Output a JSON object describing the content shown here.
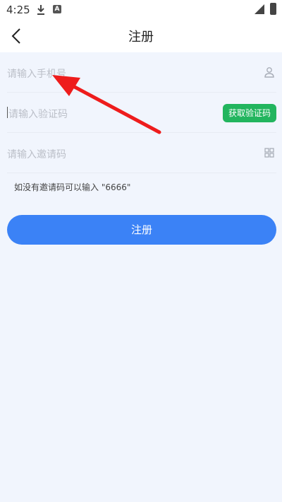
{
  "status_bar": {
    "time": "4:25"
  },
  "header": {
    "title": "注册"
  },
  "form": {
    "phone_placeholder": "请输入手机号",
    "code_placeholder": "请输入验证码",
    "get_code_label": "获取验证码",
    "invite_placeholder": "请输入邀请码",
    "hint": "如没有邀请码可以输入 \"6666\"",
    "submit_label": "注册"
  },
  "colors": {
    "primary": "#3b82f6",
    "green": "#22b55e",
    "background": "#f1f5fd",
    "annotation_arrow": "#ee1c1c"
  }
}
